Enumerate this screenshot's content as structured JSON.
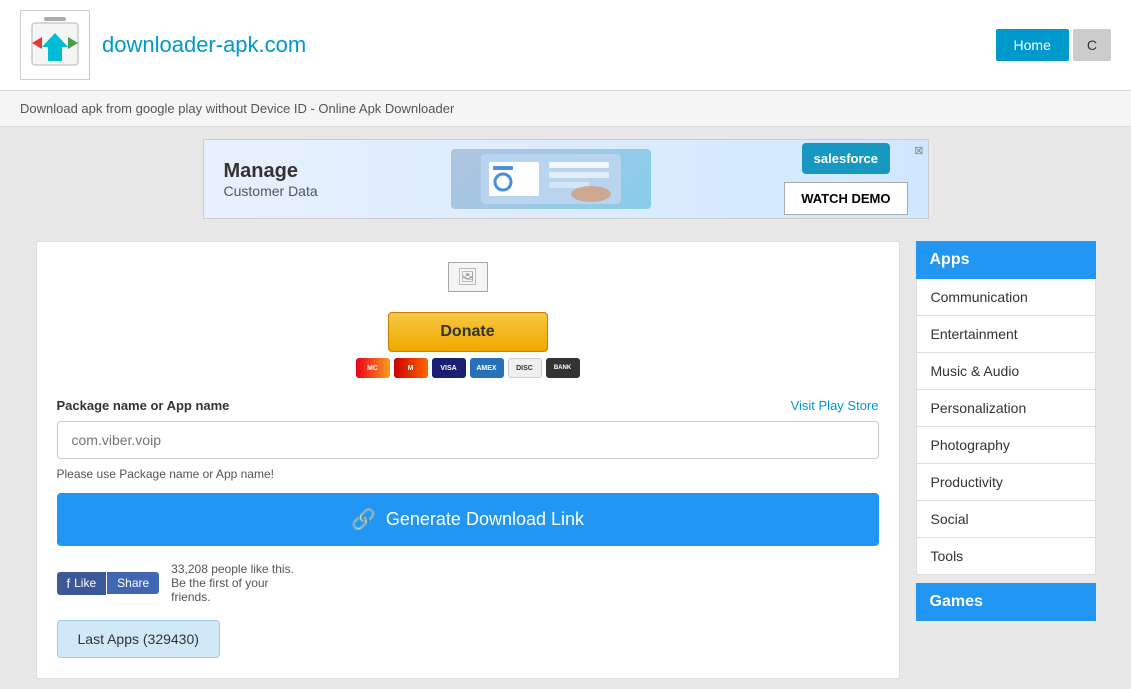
{
  "header": {
    "logo_text": "downloader-apk.com",
    "home_btn": "Home",
    "other_btn": "C"
  },
  "subtitle": "Download apk from google play without Device ID - Online Apk Downloader",
  "ad": {
    "title": "Manage",
    "subtitle": "Customer Data",
    "sf_label": "salesforce",
    "watch_label": "WATCH DEMO",
    "close": "⊠"
  },
  "donate": {
    "btn_label": "Donate",
    "payment_icons": [
      "MC",
      "VISA",
      "AMEX",
      "D",
      "BANK"
    ]
  },
  "form": {
    "label": "Package name or App name",
    "visit_link": "Visit Play Store",
    "placeholder": "com.viber.voip",
    "hint": "Please use Package name or App name!",
    "generate_btn": "Generate Download Link"
  },
  "social": {
    "like_btn": "Like",
    "share_btn": "Share",
    "count_text": "33,208 people like this.",
    "first_text": "Be the first of your",
    "friends_text": "friends."
  },
  "last_apps_btn": "Last Apps (329430)",
  "sidebar": {
    "apps_header": "Apps",
    "apps_items": [
      "Communication",
      "Entertainment",
      "Music & Audio",
      "Personalization",
      "Photography",
      "Productivity",
      "Social",
      "Tools"
    ],
    "games_header": "Games"
  }
}
